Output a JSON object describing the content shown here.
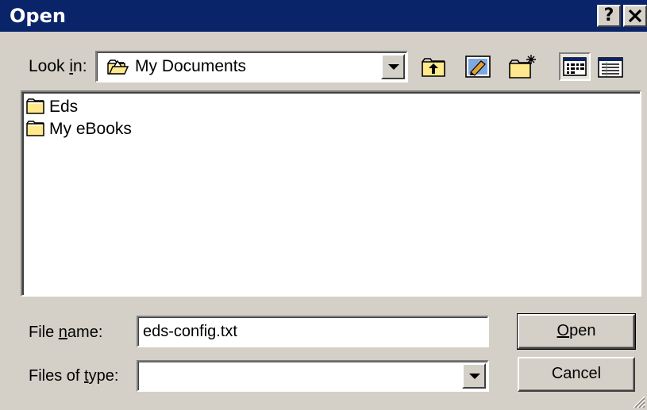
{
  "window": {
    "title": "Open",
    "help_button": "?",
    "close_button": "✕"
  },
  "toolbar": {
    "lookin_label_pre": "Look ",
    "lookin_label_key": "i",
    "lookin_label_post": "n:",
    "lookin_value": "My Documents",
    "lookin_icon": "folder-open-icon",
    "buttons": [
      {
        "name": "up-one-level-button",
        "icon": "folder-up-icon"
      },
      {
        "name": "desktop-button",
        "icon": "desktop-icon"
      },
      {
        "name": "new-folder-button",
        "icon": "new-folder-icon"
      },
      {
        "name": "list-view-button",
        "icon": "list-view-icon",
        "pressed": true
      },
      {
        "name": "details-view-button",
        "icon": "details-view-icon"
      }
    ]
  },
  "files": [
    {
      "name": "Eds",
      "icon": "folder-icon"
    },
    {
      "name": "My eBooks",
      "icon": "folder-icon"
    }
  ],
  "filename": {
    "label_pre": "File ",
    "label_key": "n",
    "label_post": "ame:",
    "value": "eds-config.txt"
  },
  "filetype": {
    "label_pre": "Files of ",
    "label_key": "t",
    "label_post": "ype:",
    "value": ""
  },
  "actions": {
    "open_key": "O",
    "open_rest": "pen",
    "cancel_label": "Cancel"
  },
  "colors": {
    "titlebar": "#0a246a",
    "face": "#d4d0c8",
    "folder": "#ffe98c"
  }
}
